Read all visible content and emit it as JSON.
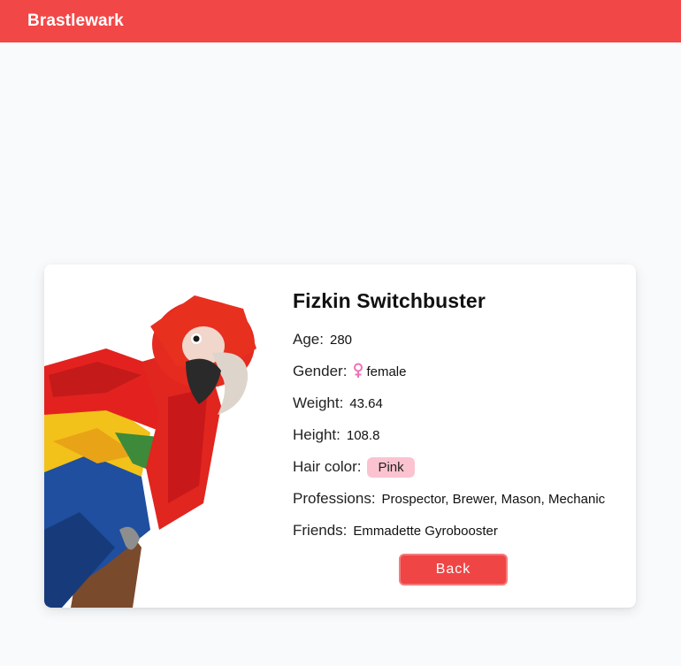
{
  "header": {
    "title": "Brastlewark",
    "bg_color": "#f24747"
  },
  "gnome": {
    "name": "Fizkin Switchbuster",
    "photo_icon": "parrot-image",
    "age_label": "Age:",
    "age": "280",
    "gender_label": "Gender:",
    "gender_icon": "female-icon",
    "gender": "female",
    "weight_label": "Weight:",
    "weight": "43.64",
    "height_label": "Height:",
    "height": "108.8",
    "hair_color_label": "Hair color:",
    "hair_color": "Pink",
    "hair_color_badge_color": "#fbc3d0",
    "professions_label": "Professions:",
    "professions": "Prospector, Brewer, Mason, Mechanic",
    "friends_label": "Friends:",
    "friends": "Emmadette Gyrobooster"
  },
  "actions": {
    "back_label": "Back",
    "accent_color": "#f04545"
  }
}
